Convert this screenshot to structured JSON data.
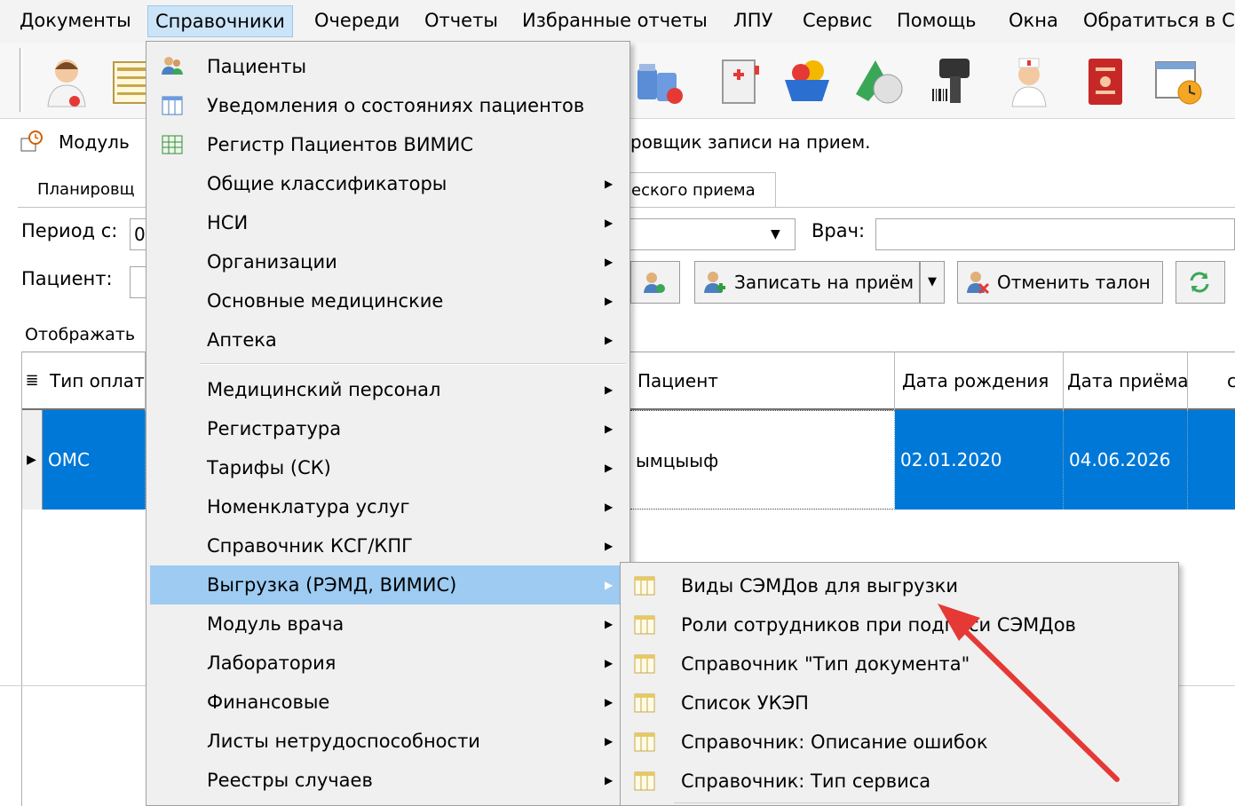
{
  "menubar": {
    "items": [
      {
        "label": "Документы"
      },
      {
        "label": "Справочники"
      },
      {
        "label": "Очереди"
      },
      {
        "label": "Отчеты"
      },
      {
        "label": "Избранные отчеты"
      },
      {
        "label": "ЛПУ"
      },
      {
        "label": "Сервис"
      },
      {
        "label": "Помощь"
      },
      {
        "label": "Окна"
      },
      {
        "label": "Обратиться в С"
      }
    ]
  },
  "module": {
    "title_left": "Модуль",
    "title_right": "ровщик записи на прием."
  },
  "tabs": {
    "left": "Планировщ",
    "right": "еского приема"
  },
  "filters": {
    "period_label": "Период с:",
    "period_value": "0",
    "doctor_label": "Врач:",
    "doctor_value": "",
    "patient_label": "Пациент:",
    "patient_value": "",
    "display_label": "Отображать"
  },
  "buttons": {
    "book": "Записать на приём",
    "cancel_ticket": "Отменить талон"
  },
  "grid": {
    "columns": {
      "payment": "Тип оплаты",
      "patient": "Пациент",
      "birth": "Дата рождения",
      "visit": "Дата приёма",
      "extra": "с"
    },
    "row": {
      "payment": "ОМС",
      "patient": "ымцыыф",
      "birth": "02.01.2020",
      "visit": "04.06.2026"
    }
  },
  "dropdown": {
    "items": [
      {
        "label": "Пациенты",
        "icon": "patients-icon"
      },
      {
        "label": "Уведомления о состояниях пациентов",
        "icon": "table-icon"
      },
      {
        "label": "Регистр Пациентов ВИМИС",
        "icon": "register-icon"
      },
      {
        "label": "Общие классификаторы"
      },
      {
        "label": "НСИ"
      },
      {
        "label": "Организации"
      },
      {
        "label": "Основные медицинские"
      },
      {
        "label": "Аптека"
      },
      {
        "label": "Медицинский персонал"
      },
      {
        "label": "Регистратура"
      },
      {
        "label": "Тарифы (СК)"
      },
      {
        "label": "Номенклатура услуг"
      },
      {
        "label": "Справочник КСГ/КПГ"
      },
      {
        "label": "Выгрузка (РЭМД, ВИМИС)"
      },
      {
        "label": "Модуль врача"
      },
      {
        "label": "Лаборатория"
      },
      {
        "label": "Финансовые"
      },
      {
        "label": "Листы нетрудоспособности"
      },
      {
        "label": "Реестры случаев"
      }
    ]
  },
  "submenu": {
    "items": [
      {
        "label": "Виды СЭМДов для выгрузки"
      },
      {
        "label": "Роли сотрудников при подписи СЭМДов"
      },
      {
        "label": "Справочник \"Тип документа\""
      },
      {
        "label": "Список УКЭП"
      },
      {
        "label": "Справочник: Описание ошибок"
      },
      {
        "label": "Справочник: Тип сервиса"
      }
    ]
  },
  "colors": {
    "selection": "#0078d7",
    "menu_highlight": "#9dcbf2",
    "annotation_arrow": "#e53935"
  }
}
